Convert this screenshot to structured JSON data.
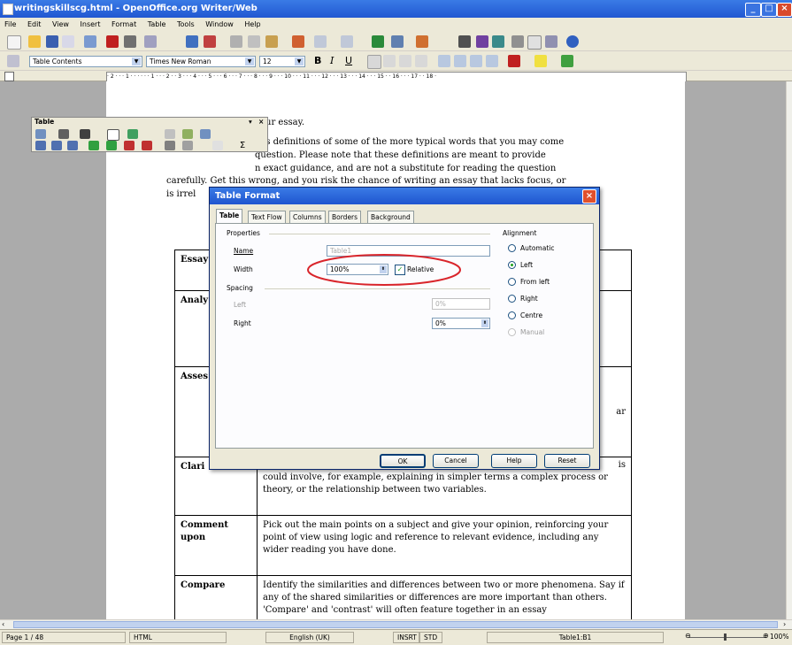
{
  "window": {
    "title": "writingskillscg.html - OpenOffice.org Writer/Web"
  },
  "menu": [
    "File",
    "Edit",
    "View",
    "Insert",
    "Format",
    "Table",
    "Tools",
    "Window",
    "Help"
  ],
  "format_bar": {
    "style": "Table Contents",
    "font": "Times New Roman",
    "size": "12"
  },
  "ruler": {
    "labels": "· 2 · · · 1 · · ·  · · · 1 · · · 2 · · 3 · · · 4 · · · 5 · · · 6 · · · 7 · · · 8 · · · 9 · · · 10 · · · 11 · · · 12 · · · 13 · · · 14 · · · 15 · · 16 · · · 17 · · 18 ·"
  },
  "table_toolbar": {
    "title": "Table"
  },
  "doc": {
    "lines": [
      "our essay.",
      "des definitions of some of the more typical words that you may come",
      "question. Please note that these definitions are meant to provide",
      "n exact guidance, and are not a substitute for reading the question",
      "carefully. Get this wrong, and you risk the chance of writing an essay that lacks focus, or",
      "is irrel"
    ],
    "rows": [
      {
        "term": "Essay",
        "def": ""
      },
      {
        "term": "Analy",
        "def": ""
      },
      {
        "term": "Asses",
        "def": ""
      },
      {
        "term": "Clari",
        "def": "could involve, for example, explaining in simpler terms a complex process or theory, or the relationship between two variables."
      },
      {
        "term": "Comment upon",
        "def": "Pick out the main points on a subject and give your opinion, reinforcing your point of view using logic and reference to relevant evidence, including any wider reading you have done."
      },
      {
        "term": "Compare",
        "def": "Identify the similarities and differences between two or more phenomena. Say if any of the shared similarities or differences are more important than others. 'Compare' and 'contrast' will often feature together in an essay"
      }
    ],
    "fragments": {
      "clari_end": "is",
      "asses_end": "ar"
    }
  },
  "dialog": {
    "title": "Table Format",
    "tabs": [
      "Table",
      "Text Flow",
      "Columns",
      "Borders",
      "Background"
    ],
    "properties_label": "Properties",
    "name_label": "Name",
    "name_value": "Table1",
    "width_label": "Width",
    "width_value": "100%",
    "relative_label": "Relative",
    "spacing_label": "Spacing",
    "left_label": "Left",
    "left_value": "0%",
    "right_label": "Right",
    "right_value": "0%",
    "alignment_label": "Alignment",
    "alignment_options": [
      "Automatic",
      "Left",
      "From left",
      "Right",
      "Centre",
      "Manual"
    ],
    "alignment_selected": "Left",
    "buttons": {
      "ok": "OK",
      "cancel": "Cancel",
      "help": "Help",
      "reset": "Reset"
    }
  },
  "status": {
    "page": "Page 1 / 48",
    "mode": "HTML",
    "language": "English (UK)",
    "insert": "INSRT",
    "std": "STD",
    "cell": "Table1:B1",
    "zoom": "100%"
  },
  "colors": {
    "titlebar": "#2157d1",
    "annotation": "#d9252b",
    "chrome": "#ece9d8"
  }
}
